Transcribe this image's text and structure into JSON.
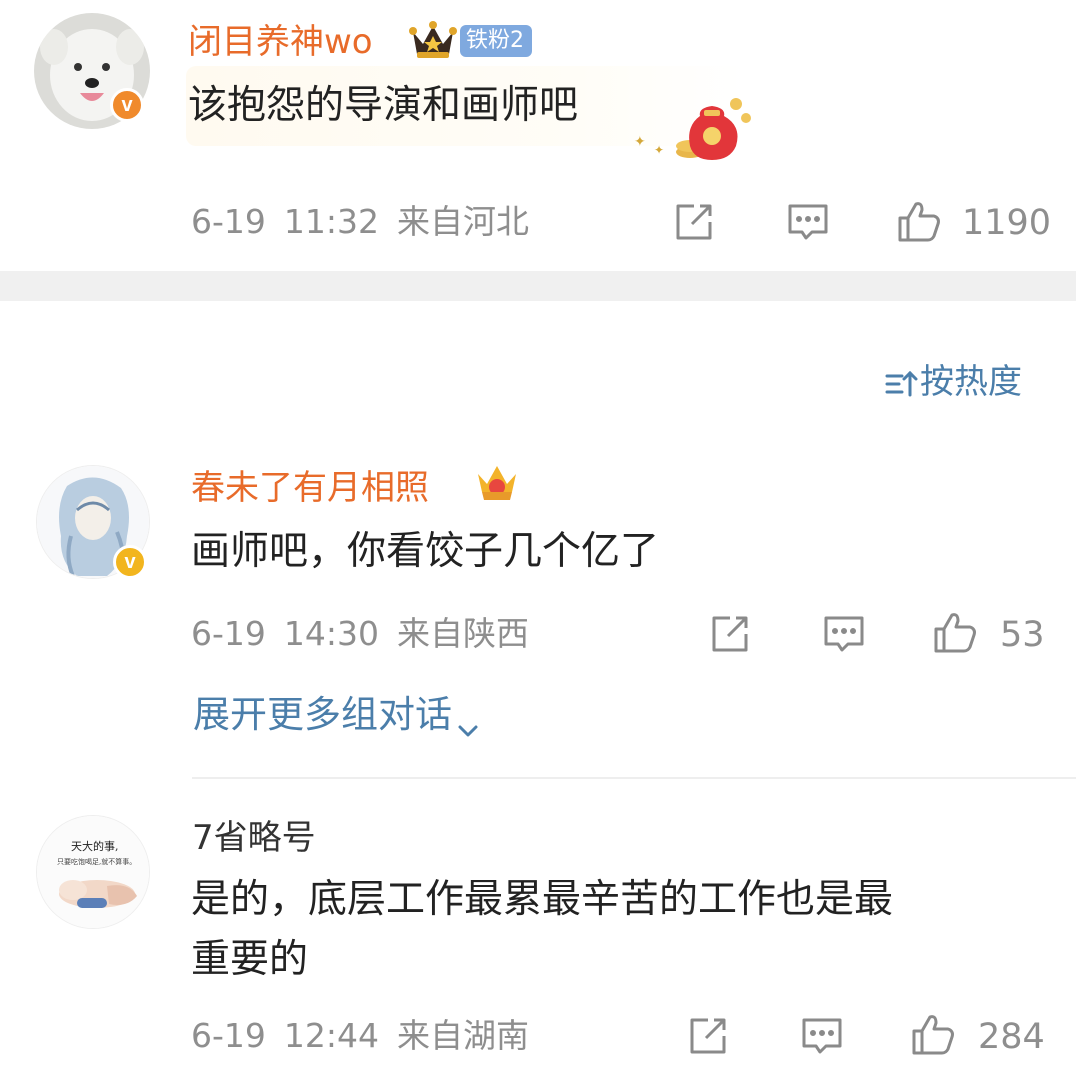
{
  "comments": [
    {
      "username": "闭目养神wo",
      "fan_badge": "铁粉2",
      "text": "该抱怨的导演和画师吧",
      "date": "6-19",
      "time": "11:32",
      "location": "来自河北",
      "likes": "1190",
      "name_color": "#e86b2a",
      "badge_color": "#f08a2c"
    },
    {
      "username": "春未了有月相照",
      "text": "画师吧，你看饺子几个亿了",
      "date": "6-19",
      "time": "14:30",
      "location": "来自陕西",
      "likes": "53",
      "name_color": "#e86b2a",
      "badge_color": "#f2b51e"
    },
    {
      "username": "7省略号",
      "text_line1": "是的，底层工作最累最辛苦的工作也是最",
      "text_line2": "重要的",
      "date": "6-19",
      "time": "12:44",
      "location": "来自湖南",
      "likes": "284",
      "avatar_text_1": "天大的事,",
      "avatar_text_2": "只要吃饱喝足,就不算事。"
    }
  ],
  "sort": {
    "label": "按热度",
    "icon": "sort-icon"
  },
  "expand_label": "展开更多组对话",
  "colors": {
    "link": "#4b7eaa",
    "meta": "#8e8e8e",
    "accent": "#e86b2a"
  }
}
